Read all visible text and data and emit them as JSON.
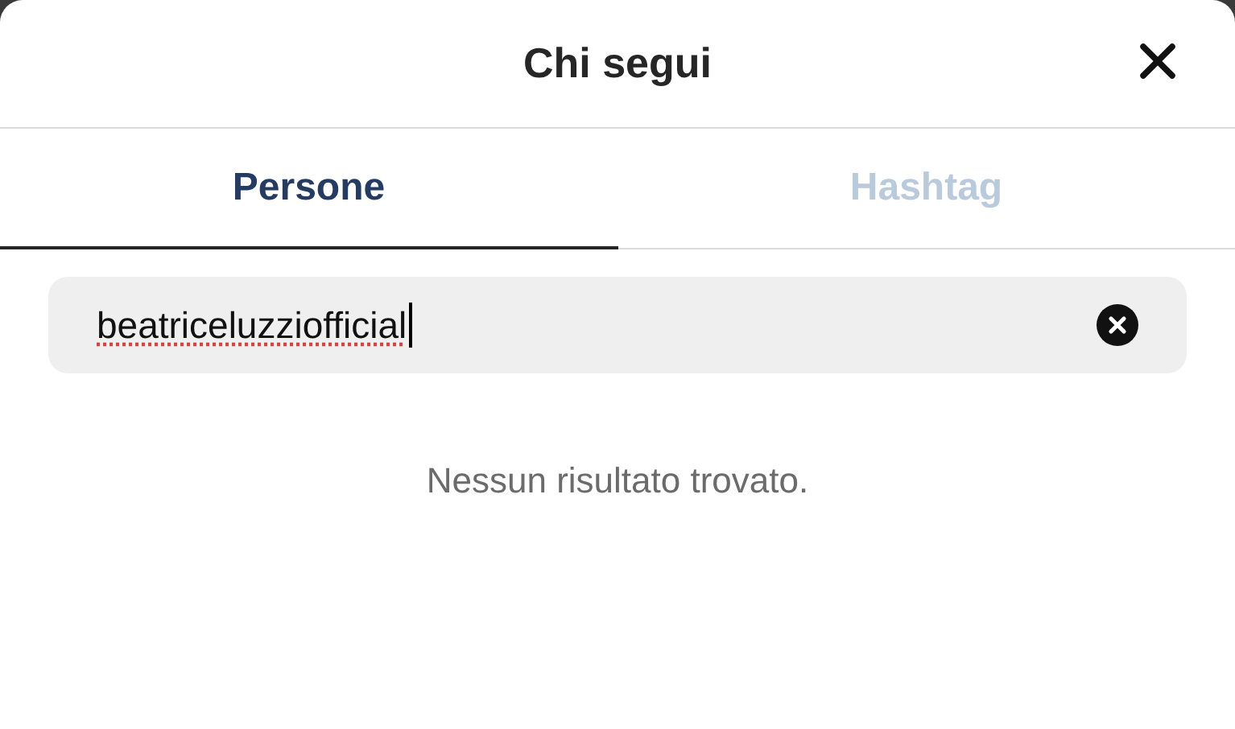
{
  "dialog": {
    "title": "Chi segui"
  },
  "tabs": [
    {
      "label": "Persone",
      "selected": true
    },
    {
      "label": "Hashtag",
      "selected": false
    }
  ],
  "search": {
    "value": "beatriceluzziofficial",
    "spellcheck_error": true
  },
  "message": "Nessun risultato trovato."
}
